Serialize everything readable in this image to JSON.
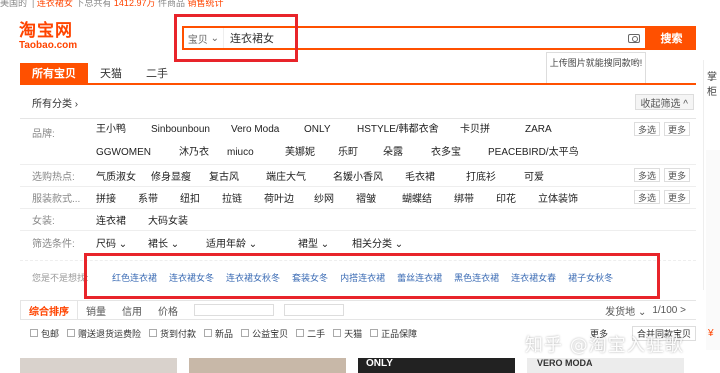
{
  "topbar": {
    "left": "美国的",
    "center_prefix": "连衣裙女",
    "center_mid": "下总共有",
    "count": "1412.97万",
    "suffix": "件商品",
    "stats": "销售统计"
  },
  "logo": {
    "cn": "淘宝网",
    "en": "Taobao.com"
  },
  "search": {
    "category": "宝贝",
    "query": "连衣裙女",
    "button": "搜索"
  },
  "tip": {
    "text": "上传图片就能搜同款哟!"
  },
  "tabs": [
    {
      "label": "所有宝贝",
      "active": true
    },
    {
      "label": "天猫"
    },
    {
      "label": "二手"
    }
  ],
  "right_cut": {
    "label": "掌柜",
    "price": "¥"
  },
  "allcat": {
    "label": "所有分类 ›",
    "collapse": "收起筛选 ^"
  },
  "filters": [
    {
      "label": "品牌:",
      "values": [
        "王小鸭",
        "Sinbounboun",
        "Vero Moda",
        "ONLY",
        "HSTYLE/韩都衣舍",
        "卡贝拼",
        "ZARA",
        "GGWOMEN",
        "沐乃衣",
        "miuco",
        "芙娜妮",
        "乐町",
        "朵露",
        "衣多宝",
        "PEACEBIRD/太平鸟"
      ],
      "more": "多选",
      "more2": "更多"
    },
    {
      "label": "选购热点:",
      "values": [
        "气质淑女",
        "修身显瘦",
        "复古风",
        "端庄大气",
        "名媛小香风",
        "毛衣裙",
        "打底衫",
        "可爱"
      ],
      "more": "多选",
      "more2": "更多"
    },
    {
      "label": "服装款式...",
      "values": [
        "拼接",
        "系带",
        "纽扣",
        "拉链",
        "荷叶边",
        "纱网",
        "褶皱",
        "蝴蝶结",
        "绑带",
        "印花",
        "立体装饰"
      ],
      "more": "多选",
      "more2": "更多"
    },
    {
      "label": "女装:",
      "values": [
        "连衣裙",
        "大码女装"
      ]
    },
    {
      "label": "筛选条件:",
      "values": [
        "尺码 ⌄",
        "裙长 ⌄",
        "适用年龄 ⌄",
        "裙型 ⌄",
        "相关分类 ⌄"
      ]
    }
  ],
  "guess": {
    "label": "您是不是想找:",
    "keywords": [
      "红色连衣裙",
      "连衣裙女冬",
      "连衣裙女秋冬",
      "套装女冬",
      "内搭连衣裙",
      "蕾丝连衣裙",
      "黑色连衣裙",
      "连衣裙女春",
      "裙子女秋冬"
    ]
  },
  "sort": {
    "items": [
      "综合排序",
      "销量",
      "信用",
      "价格"
    ],
    "right": "发货地 ⌄",
    "page": "1/100 >"
  },
  "options": [
    "包邮",
    "赠送退货运费险",
    "货到付款",
    "新品",
    "公益宝贝",
    "二手",
    "天猫",
    "正品保障"
  ],
  "options_more": "更多",
  "options_right": "合并同款宝贝",
  "products": [
    {
      "label": ""
    },
    {
      "label": ""
    },
    {
      "label": "ONLY"
    },
    {
      "label": "VERO MODA"
    }
  ],
  "watermark": "知乎 @淘宝入驻歌"
}
